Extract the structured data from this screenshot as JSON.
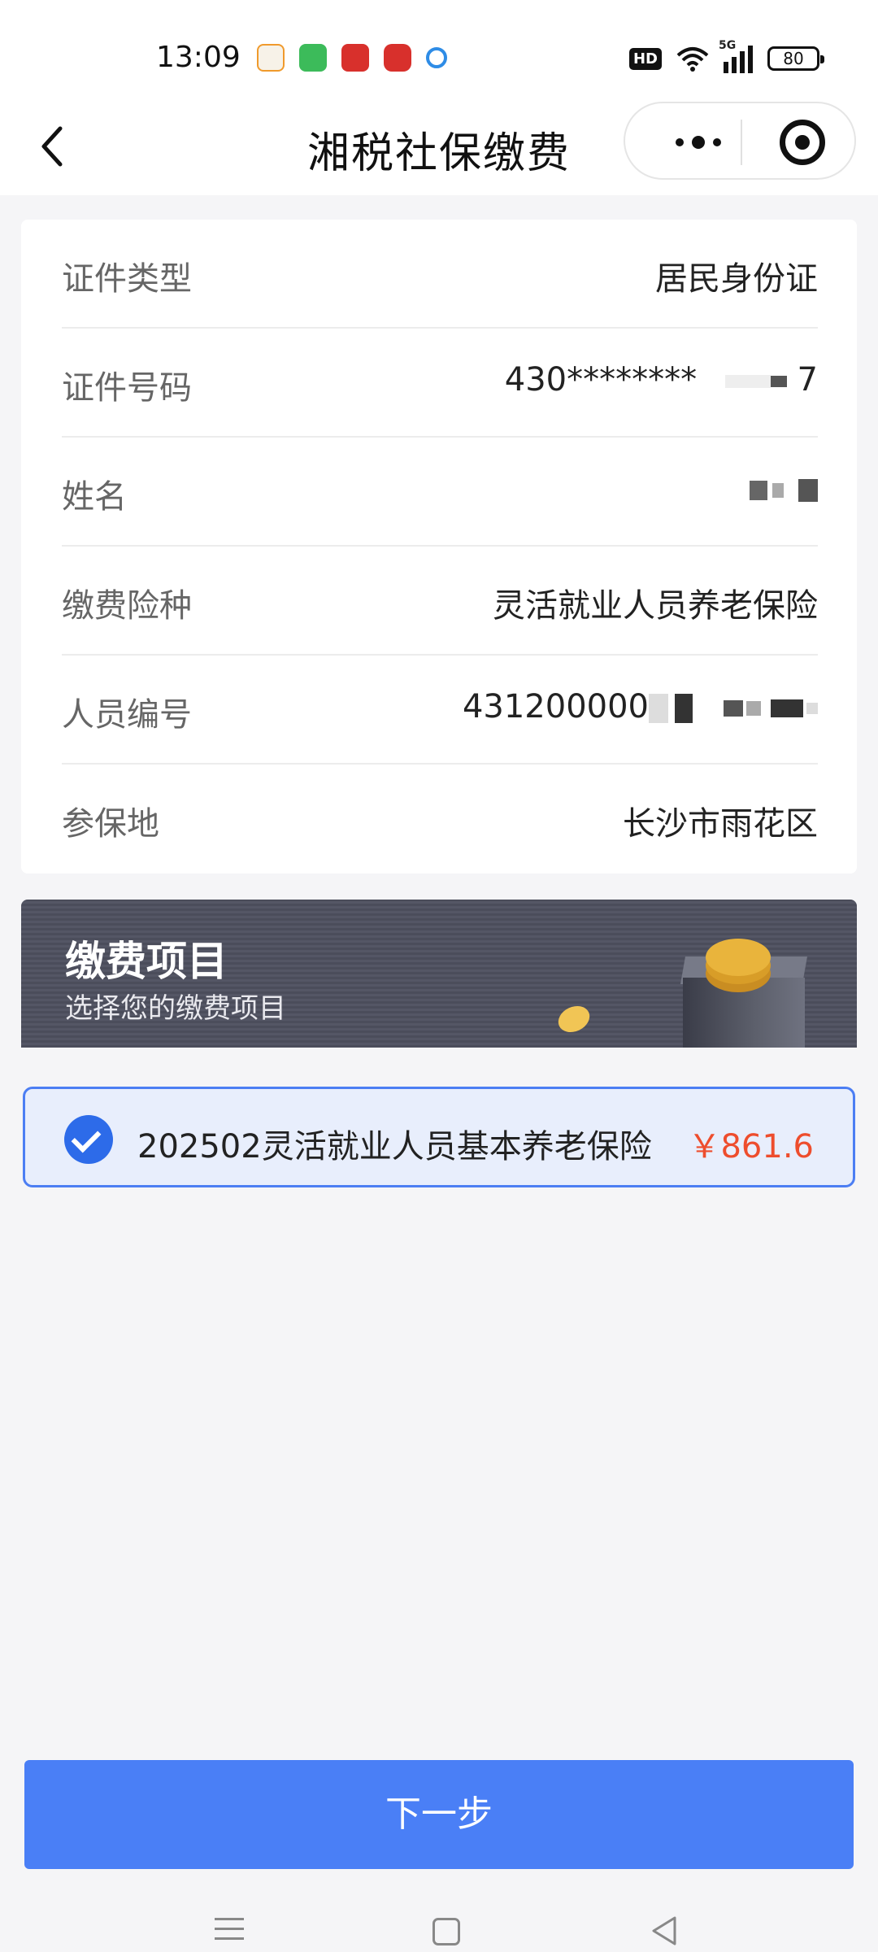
{
  "status_bar": {
    "time": "13:09",
    "network": "5G",
    "hd": "HD",
    "battery": "80",
    "notification_icons": [
      "app-icon-orange",
      "message-icon",
      "app-icon-red",
      "app-icon-red-round",
      "search-icon"
    ]
  },
  "nav": {
    "title": "湘税社保缴费"
  },
  "info": {
    "rows": [
      {
        "label": "证件类型",
        "value": "居民身份证"
      },
      {
        "label": "证件号码",
        "value": "430********",
        "tail": "7"
      },
      {
        "label": "姓名",
        "value": ""
      },
      {
        "label": "缴费险种",
        "value": "灵活就业人员养老保险"
      },
      {
        "label": "人员编号",
        "value": "431200000"
      },
      {
        "label": "参保地",
        "value": "长沙市雨花区"
      }
    ]
  },
  "banner": {
    "title": "缴费项目",
    "subtitle": "选择您的缴费项目"
  },
  "payment_item": {
    "name": "202502灵活就业人员基本养老保险",
    "amount": "￥861.6",
    "selected": true
  },
  "actions": {
    "next_label": "下一步"
  },
  "colors": {
    "primary": "#4a7ff6",
    "amount": "#ee4d2d",
    "banner": "#4b4d5b"
  }
}
